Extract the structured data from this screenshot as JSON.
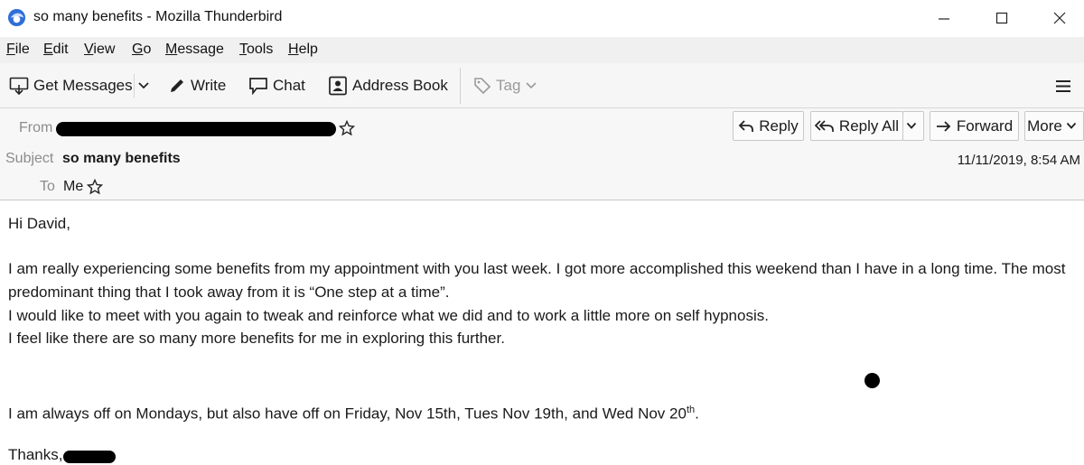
{
  "window": {
    "title": "so many benefits - Mozilla Thunderbird",
    "controls": {
      "minimize": "—",
      "maximize": "☐",
      "close": "✕"
    }
  },
  "menu": {
    "items": [
      "File",
      "Edit",
      "View",
      "Go",
      "Message",
      "Tools",
      "Help"
    ]
  },
  "toolbar": {
    "get_messages": "Get Messages",
    "write": "Write",
    "chat": "Chat",
    "address_book": "Address Book",
    "tag": "Tag"
  },
  "header": {
    "from_label": "From",
    "subject_label": "Subject",
    "subject_value": "so many benefits",
    "to_label": "To",
    "to_value": "Me",
    "date": "11/11/2019, 8:54 AM",
    "buttons": {
      "reply": "Reply",
      "reply_all": "Reply All",
      "forward": "Forward",
      "more": "More"
    }
  },
  "body": {
    "greeting": "Hi David,",
    "para1": "I am really experiencing some benefits from my appointment with you last week. I got more accomplished this weekend than I have in a long time.  The most predominant thing that I took away from it is “One step at a time”.",
    "para2": "I would like to meet with you again to tweak and reinforce what we did and to work a little more on self hypnosis.",
    "para3": "I feel like there are so many more benefits for me in exploring this further.",
    "para4_main": "I am always off on Mondays, but also have off on Friday, Nov 15th, Tues Nov 19th, and Wed Nov 20",
    "para4_sup": "th",
    "para4_end": ".",
    "closing": "Thanks,"
  },
  "colors": {
    "menubar": "#f0f0f0",
    "toolbar": "#f6f6f6",
    "header": "#f7f7f7",
    "label_gray": "#8c8c8c"
  }
}
